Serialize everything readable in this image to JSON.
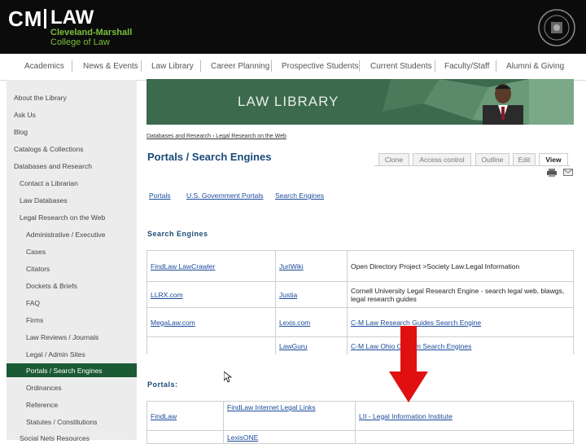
{
  "header": {
    "logo_cm": "CM",
    "logo_law": "LAW",
    "logo_line1": "Cleveland-Marshall",
    "logo_line2": "College of Law"
  },
  "nav": {
    "items": [
      "Academics",
      "News & Events",
      "Law Library",
      "Career Planning",
      "Prospective Students",
      "Current Students",
      "Faculty/Staff",
      "Alumni & Giving"
    ]
  },
  "sidebar": {
    "items": [
      "About the Library",
      "Ask Us",
      "Blog",
      "Catalogs & Collections",
      "Databases and Research",
      "Contact a Librarian",
      "Law Databases",
      "Legal Research on the Web",
      "Administrative / Executive",
      "Cases",
      "Citators",
      "Dockets & Briefs",
      "FAQ",
      "Firms",
      "Law Reviews / Journals",
      "Legal / Admin Sites",
      "Portals / Search Engines",
      "Ordinances",
      "Reference",
      "Statutes / Constitutions",
      "Social Nets Resources"
    ]
  },
  "banner": {
    "title": "LAW LIBRARY"
  },
  "breadcrumb": "Databases and Research › Legal Research on the Web",
  "page_title": "Portals / Search Engines",
  "tabs": [
    "Clone",
    "Access control",
    "Outline",
    "Edit",
    "View"
  ],
  "toc": [
    "Portals",
    "U.S. Government Portals",
    "Search Engines"
  ],
  "search_engines": {
    "heading": "Search Engines",
    "rows": [
      [
        "FindLaw LawCrawler",
        "JuriWiki",
        "Open Directory Project >Society Law:Legal Information"
      ],
      [
        "LLRX.com",
        "Justia",
        "Cornell University Legal Research Engine - search legal web, blawgs, legal research guides"
      ],
      [
        "MegaLaw.com",
        "Lexis.com",
        "C-M Law Research Guides Search Engine"
      ],
      [
        "",
        "LawGuru",
        "C-M Law Ohio Custom Search Engines"
      ]
    ]
  },
  "portals": {
    "heading": "Portals:",
    "rows": [
      [
        "FindLaw",
        "FindLaw Internet Legal Links",
        "LII - Legal Information Institute"
      ],
      [
        "",
        "LexisONE",
        ""
      ]
    ]
  },
  "colors": {
    "header_bg": "#0b0b0b",
    "brand_green": "#7cbf3a",
    "banner_green": "#3c6a4d",
    "active_green": "#1a5a34",
    "title_blue": "#1a4a78",
    "arrow_red": "#e01010"
  },
  "icons": [
    "seal-icon",
    "print-icon",
    "email-icon",
    "cursor-icon",
    "red-arrow-icon"
  ]
}
